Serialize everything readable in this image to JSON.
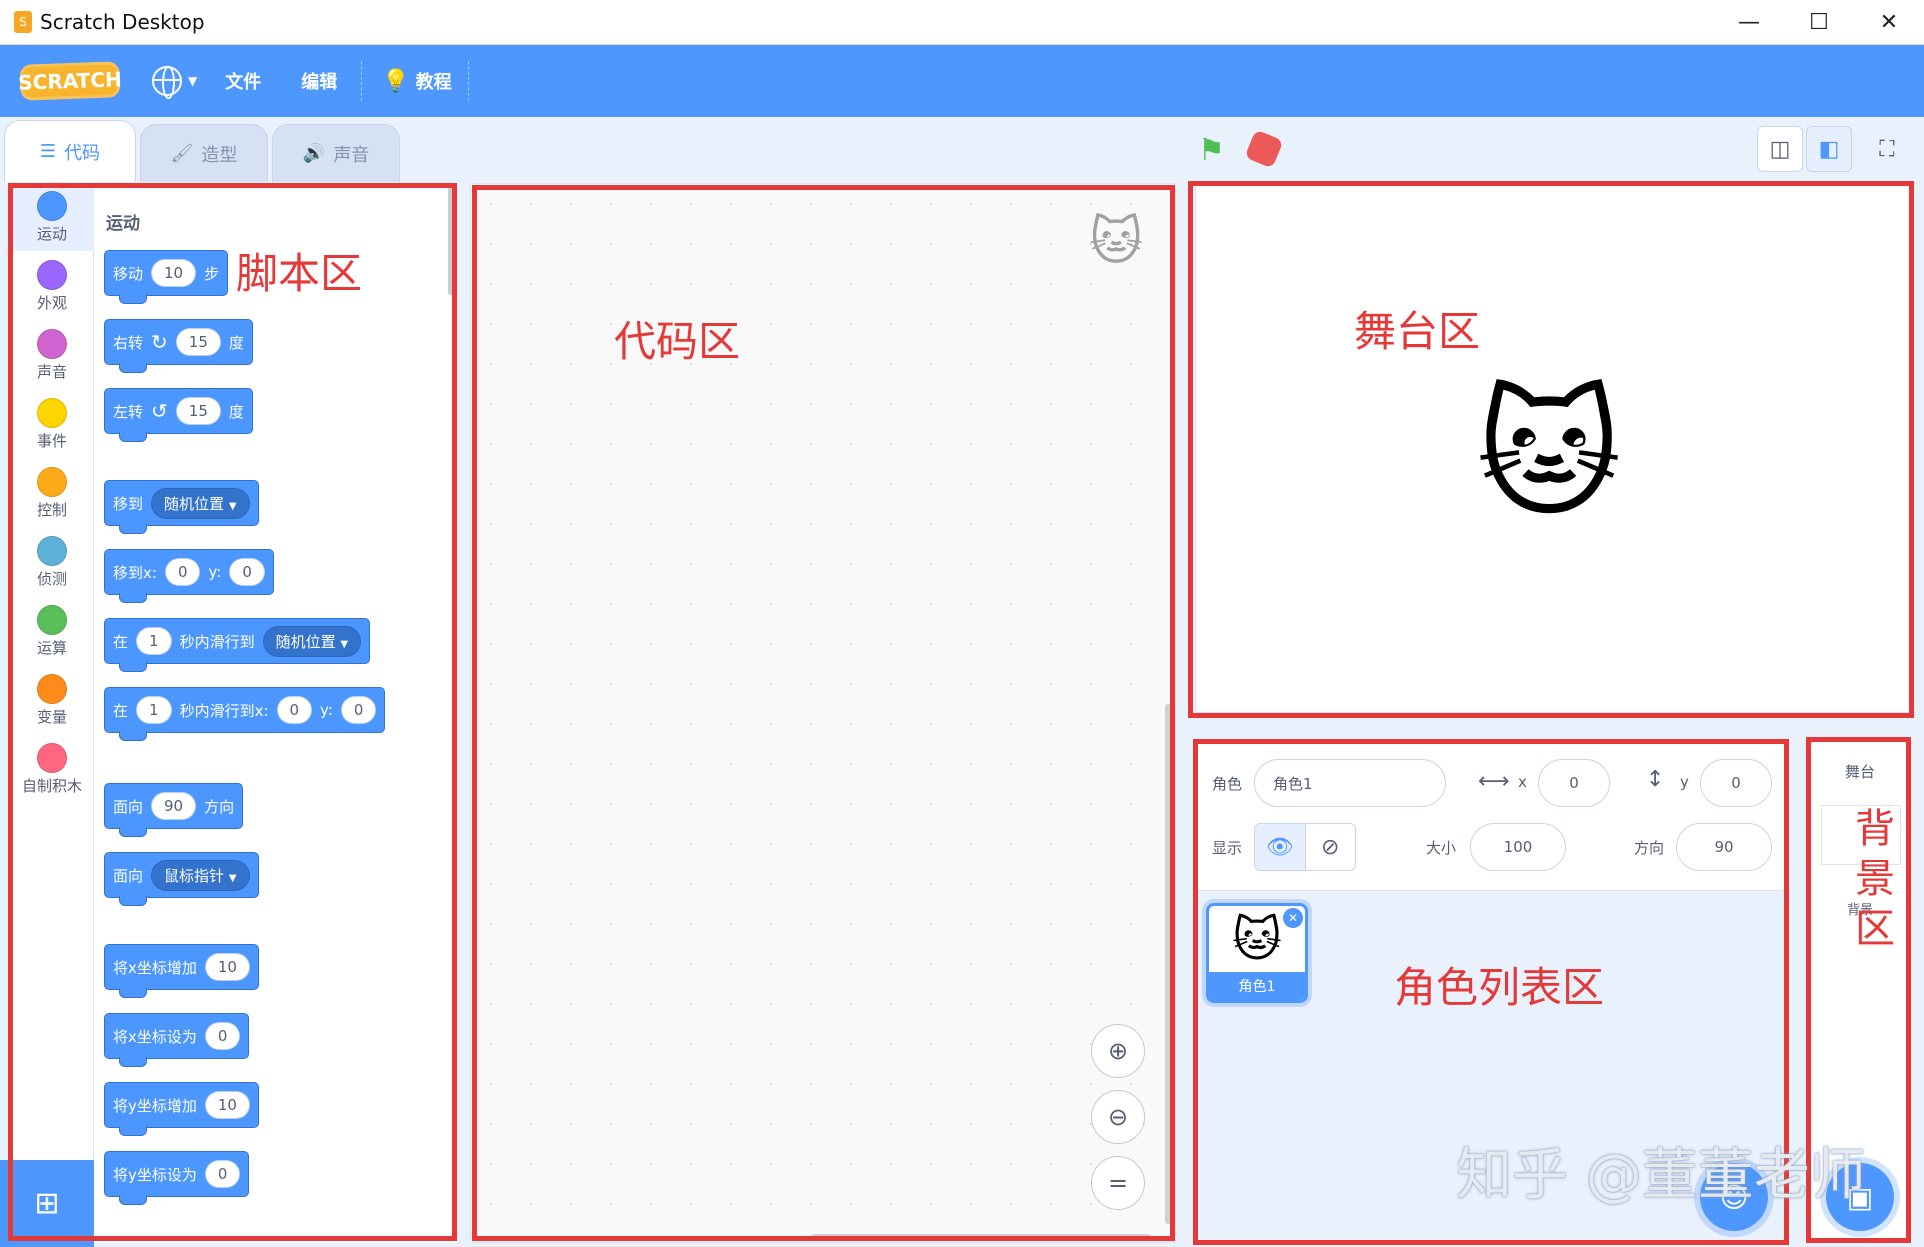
{
  "window": {
    "title": "Scratch Desktop",
    "controls": [
      "—",
      "☐",
      "✕"
    ]
  },
  "menubar": {
    "logo": "SCRATCH",
    "file": "文件",
    "edit": "编辑",
    "tutorials": "教程"
  },
  "tabs": [
    {
      "label": "代码",
      "icon": "code-icon",
      "active": true
    },
    {
      "label": "造型",
      "icon": "brush-icon",
      "active": false
    },
    {
      "label": "声音",
      "icon": "speaker-icon",
      "active": false
    }
  ],
  "categories": [
    {
      "label": "运动",
      "color": "#4c97ff"
    },
    {
      "label": "外观",
      "color": "#9966ff"
    },
    {
      "label": "声音",
      "color": "#cf63cf"
    },
    {
      "label": "事件",
      "color": "#ffd500"
    },
    {
      "label": "控制",
      "color": "#ffab19"
    },
    {
      "label": "侦测",
      "color": "#5cb1d6"
    },
    {
      "label": "运算",
      "color": "#59c059"
    },
    {
      "label": "变量",
      "color": "#ff8c1a"
    },
    {
      "label": "自制积木",
      "color": "#ff6680"
    }
  ],
  "palette": {
    "heading": "运动",
    "blocks": {
      "move": {
        "label": "移动",
        "value": "10",
        "unit": "步"
      },
      "turn_right": {
        "label": "右转",
        "value": "15",
        "unit": "度"
      },
      "turn_left": {
        "label": "左转",
        "value": "15",
        "unit": "度"
      },
      "goto": {
        "label": "移到",
        "dropdown": "随机位置"
      },
      "goto_xy": {
        "label": "移到x:",
        "x": "0",
        "ylabel": "y:",
        "y": "0"
      },
      "glide": {
        "label": "在",
        "secs": "1",
        "mid": "秒内滑行到",
        "dropdown": "随机位置"
      },
      "glide_xy": {
        "label": "在",
        "secs": "1",
        "mid": "秒内滑行到x:",
        "x": "0",
        "ylabel": "y:",
        "y": "0"
      },
      "point_dir": {
        "label": "面向",
        "value": "90",
        "unit": "方向"
      },
      "point_towards": {
        "label": "面向",
        "dropdown": "鼠标指针"
      },
      "change_x": {
        "label": "将x坐标增加",
        "value": "10"
      },
      "set_x": {
        "label": "将x坐标设为",
        "value": "0"
      },
      "change_y": {
        "label": "将y坐标增加",
        "value": "10"
      },
      "set_y": {
        "label": "将y坐标设为",
        "value": "0"
      }
    }
  },
  "sprite_info": {
    "sprite_label": "角色",
    "sprite_name": "角色1",
    "x_label": "x",
    "x": "0",
    "y_label": "y",
    "y": "0",
    "show_label": "显示",
    "size_label": "大小",
    "size": "100",
    "direction_label": "方向",
    "direction": "90"
  },
  "sprite_list": [
    {
      "name": "角色1"
    }
  ],
  "backdrop": {
    "title": "舞台",
    "label": "背景"
  },
  "annotations": {
    "script_area": "脚本区",
    "code_area": "代码区",
    "stage_area": "舞台区",
    "sprite_list_area": "角色列表区",
    "backdrop_area": "背景区"
  },
  "watermark": "知乎 @董董老师"
}
